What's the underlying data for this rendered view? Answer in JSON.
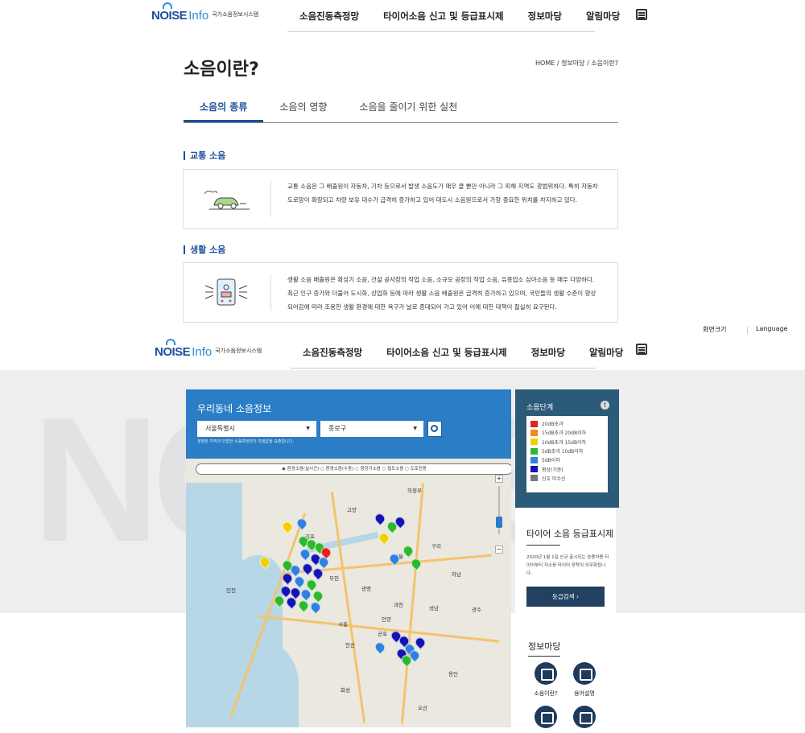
{
  "header": {
    "logo_brand": "NOISE",
    "logo_info": "Info",
    "logo_sub": "국가소음정보시스템",
    "nav": [
      "소음진동측정망",
      "타이어소음 신고 및 등급표시제",
      "정보마당",
      "알림마당"
    ]
  },
  "page": {
    "title": "소음이란?",
    "breadcrumb": "HOME  /  정보마당  /  소음이란?",
    "tabs": [
      "소음의 종류",
      "소음의 영향",
      "소음을 줄이기 위한 실천"
    ],
    "active_tab": "소음의 종류"
  },
  "sections": [
    {
      "heading": "교통 소음",
      "icon": "car-icon",
      "text": "교통 소음은 그 배출원이 자동차, 기차 등으로서 발생 소음도가 매우 클 뿐만 아니라 그 피해 지역도 광범위하다. 특히 자동차 도로망이 확장되고 차량 보유 대수가 급격히 증가하고 있어 대도시 소음원으로서 가장 중요한 위치를 차지하고 있다."
    },
    {
      "heading": "생활 소음",
      "icon": "phone-speaker-icon",
      "text": "생활 소음 배출원은 확성기 소음, 건설 공사장의 작업 소음, 소규모 공장의 작업 소음, 유흥업소 심야소음 등 매우 다양하다. 최근 인구 증가와 더불어 도시화, 상업화 등에 따라 생활 소음 배출원은 급격히 증가하고 있으며, 국민들의 생활 수준이 향상되어감에 따라 조용한 생활 환경에 대한 욕구가 날로 증대되어 가고 있어 이에 대한 대책이 절실히 요구된다."
    }
  ],
  "top_links": {
    "font_size": "화면크기",
    "language": "Language"
  },
  "map_panel": {
    "title": "우리동네 소음정보",
    "city_select": "서울특별시",
    "district_select": "종로구",
    "note": "설정한 지역과 인접한 소음측정망의 측정값을 표출합니다.",
    "radio_options": "◉ 환경소음(실시간)   ○ 환경소음(수동)   ○ 항공기소음   ○ 철도소음   ○ 도로진동",
    "cities": [
      "의정부",
      "고양",
      "김포",
      "서울",
      "구리",
      "부천",
      "인천",
      "광명",
      "과천",
      "안양",
      "성남",
      "시흥",
      "군포",
      "안산",
      "화성",
      "오산",
      "용인",
      "하남",
      "광주"
    ]
  },
  "noise_level": {
    "title": "소음단계",
    "items": [
      {
        "label": "20dB초과",
        "color": "#e8201d"
      },
      {
        "label": "15dB초과 20dB이하",
        "color": "#f58a16"
      },
      {
        "label": "10dB초과 15dB이하",
        "color": "#f2d000"
      },
      {
        "label": "5dB초과 10dB이하",
        "color": "#2eb82e"
      },
      {
        "label": "5dB이하",
        "color": "#2f80e0"
      },
      {
        "label": "평상(기준)",
        "color": "#1414b4"
      },
      {
        "label": "신호 미수신",
        "color": "#777777"
      }
    ]
  },
  "tire": {
    "title": "타이어 소음 등급표시제",
    "desc": "2020년 1월 1일 신규 출시되는 승용차용 타이어부터 저소음 타이어 장착이 의무화됩니다.",
    "button": "등급검색   ›"
  },
  "info": {
    "title": "정보마당",
    "links": [
      "소음이란?",
      "용어설명"
    ]
  }
}
